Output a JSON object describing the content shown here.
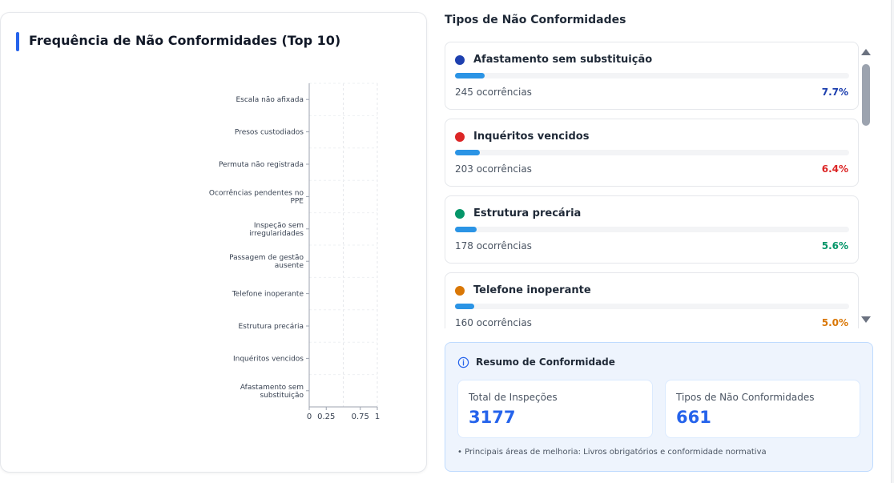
{
  "left_panel": {
    "title": "Frequência de Não Conformidades (Top 10)"
  },
  "chart_data": {
    "type": "bar",
    "orientation": "horizontal",
    "categories": [
      "Escala não afixada",
      "Presos custodiados",
      "Permuta não registrada",
      "Ocorrências pendentes no PPE",
      "Inspeção sem irregularidades",
      "Passagem de gestão ausente",
      "Telefone inoperante",
      "Estrutura precária",
      "Inquéritos vencidos",
      "Afastamento sem substituição"
    ],
    "category_lines": [
      [
        "Escala não afixada"
      ],
      [
        "Presos custodiados"
      ],
      [
        "Permuta não registrada"
      ],
      [
        "Ocorrências pendentes no",
        "PPE"
      ],
      [
        "Inspeção sem",
        "irregularidades"
      ],
      [
        "Passagem de gestão",
        "ausente"
      ],
      [
        "Telefone inoperante"
      ],
      [
        "Estrutura precária"
      ],
      [
        "Inquéritos vencidos"
      ],
      [
        "Afastamento sem",
        "substituição"
      ]
    ],
    "values": [],
    "xlim": [
      0,
      1
    ],
    "x_ticks": [
      "0",
      "0.25",
      "0.75",
      "1"
    ],
    "x_tick_values": [
      0,
      0.25,
      0.75,
      1
    ],
    "grid_ticks": [
      0,
      0.5,
      1
    ],
    "grid": true,
    "legend": "none"
  },
  "right_panel": {
    "title": "Tipos de Não Conformidades",
    "items": [
      {
        "name": "Afastamento sem substituição",
        "count": "245 ocorrências",
        "percent": "7.7%",
        "share": 0.077,
        "color": "#1e40af"
      },
      {
        "name": "Inquéritos vencidos",
        "count": "203 ocorrências",
        "percent": "6.4%",
        "share": 0.064,
        "color": "#dc2626"
      },
      {
        "name": "Estrutura precária",
        "count": "178 ocorrências",
        "percent": "5.6%",
        "share": 0.056,
        "color": "#059669"
      },
      {
        "name": "Telefone inoperante",
        "count": "160 ocorrências",
        "percent": "5.0%",
        "share": 0.05,
        "color": "#d97706"
      }
    ],
    "bar_color": "#2b94e5"
  },
  "summary": {
    "title": "Resumo de Conformidade",
    "total_label": "Total de Inspeções",
    "total_value": "3177",
    "types_label": "Tipos de Não Conformidades",
    "types_value": "661",
    "note": "• Principais áreas de melhoria: Livros obrigatórios e conformidade normativa"
  }
}
